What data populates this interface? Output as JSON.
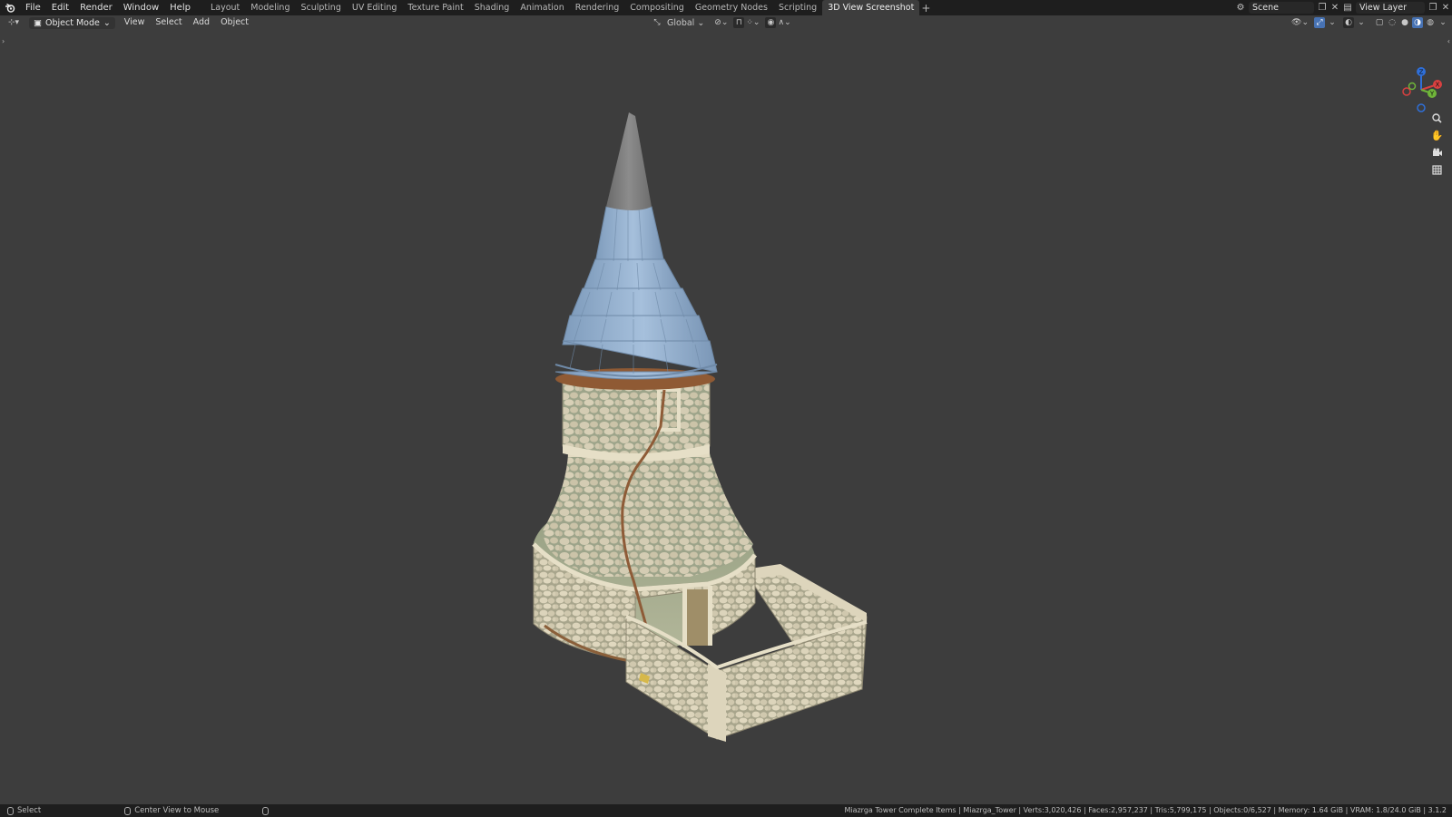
{
  "menu": [
    "File",
    "Edit",
    "Render",
    "Window",
    "Help"
  ],
  "workspaces": {
    "tabs": [
      "Layout",
      "Modeling",
      "Sculpting",
      "UV Editing",
      "Texture Paint",
      "Shading",
      "Animation",
      "Rendering",
      "Compositing",
      "Geometry Nodes",
      "Scripting",
      "3D View Screenshot"
    ],
    "active": "3D View Screenshot",
    "add_label": "+"
  },
  "scene": {
    "label": "Scene"
  },
  "view_layer": {
    "label": "View Layer"
  },
  "viewport_header": {
    "mode": "Object Mode",
    "menus": [
      "View",
      "Select",
      "Add",
      "Object"
    ],
    "orientation": "Global"
  },
  "gizmo": {
    "z": "Z",
    "y": "Y",
    "x": "X"
  },
  "icons": {
    "blender_logo": "blender-logo-icon",
    "zoom": "zoom-icon",
    "pan": "hand-icon",
    "camera": "camera-icon",
    "grid": "grid-icon"
  },
  "status": {
    "select": "Select",
    "center_view": "Center View to Mouse",
    "stats": "Miazrga Tower Complete Items | Miazrga_Tower | Verts:3,020,426 | Faces:2,957,237 | Tris:5,799,175 | Objects:0/6,527 | Memory: 1.64 GiB | VRAM: 1.8/24.0 GiB | 3.1.2"
  },
  "colors": {
    "viewport_bg": "#3d3d3d",
    "topbar_bg": "#1e1e1e",
    "roof_blue": "#8aa8c8",
    "spire_gray": "#7a7a7a",
    "stone": "#cfc7ad",
    "moss": "#a9b194",
    "wood": "#9a6440",
    "accent": "#4772b3"
  }
}
